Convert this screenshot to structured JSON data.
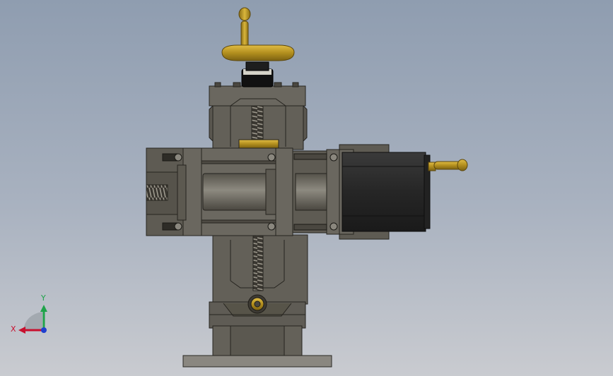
{
  "triad": {
    "x_label": "X",
    "y_label": "Y",
    "x_color": "#c8102e",
    "y_color": "#1fa34a",
    "z_color": "#1f3fcf"
  },
  "colors": {
    "background_top": "#8f9db0",
    "background_bottom": "#c9cbd0",
    "body": "#636058",
    "body_dark": "#4d4a43",
    "edge": "#26241f",
    "brass": "#b38f1e",
    "brass_light": "#d6b23a",
    "motor": "#2b2b2b"
  }
}
